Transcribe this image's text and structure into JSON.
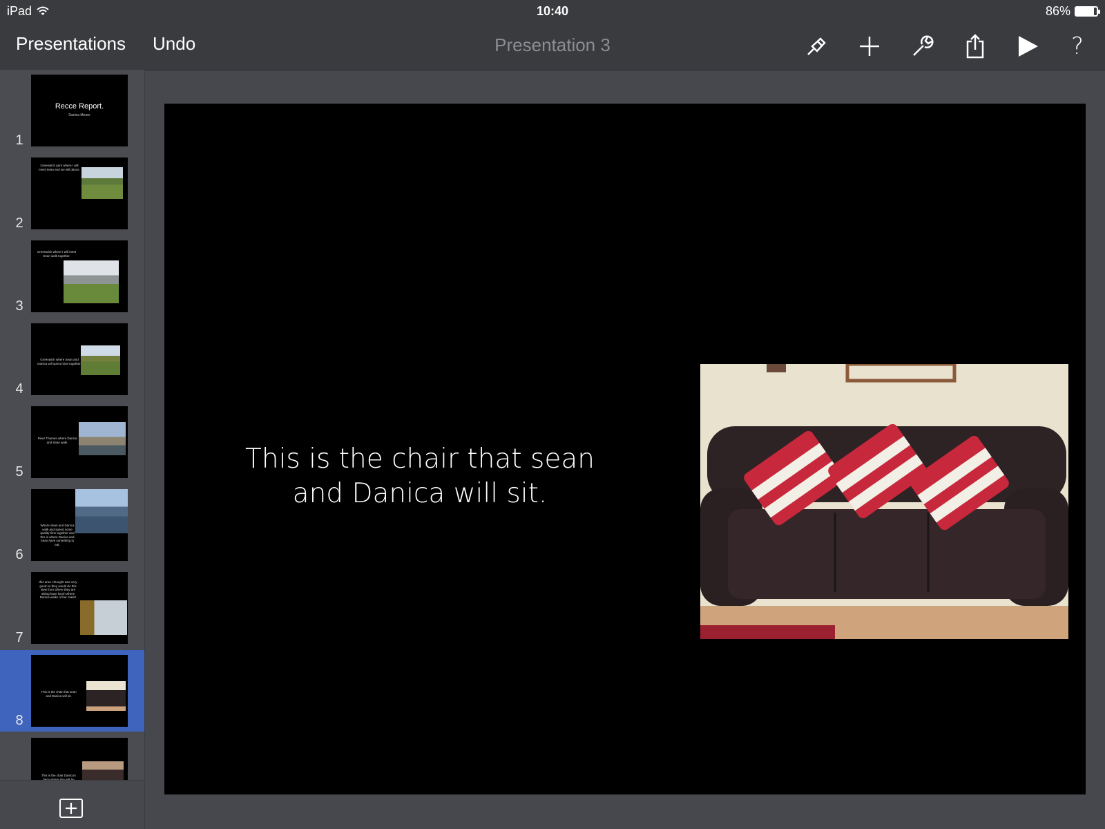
{
  "status_bar": {
    "carrier": "iPad",
    "time": "10:40",
    "battery_percent": "86%",
    "battery_level": 0.86
  },
  "toolbar": {
    "presentations_label": "Presentations",
    "undo_label": "Undo",
    "title": "Presentation 3",
    "icons": [
      "paintbrush-icon",
      "plus-icon",
      "wrench-icon",
      "share-icon",
      "play-icon",
      "help-icon"
    ],
    "help_glyph": "?"
  },
  "sidebar": {
    "selected_index": 8,
    "thumbnails": [
      {
        "number": "1",
        "title": "Recce Report.",
        "subtitle": "Danica Moore"
      },
      {
        "number": "2",
        "text": "Greenwich park where I will meet Sean and we will dance."
      },
      {
        "number": "3",
        "text": "Greenwich where I will meet Sean walk together."
      },
      {
        "number": "4",
        "text": "Greenwich where Sean and Danica will spend time together."
      },
      {
        "number": "5",
        "text": "River Thames where Danica and Sean walk."
      },
      {
        "number": "6",
        "text": "Where Sean and Danica walk and spend some quality time together and this is where Danica and Sean have something to eat."
      },
      {
        "number": "7",
        "text": "this area I thought was very good so they would do this view from where they are sitting have lunch where Danica walks of her match"
      },
      {
        "number": "8",
        "text": "This is the chair that sean and Danica will sit."
      },
      {
        "number": "",
        "text": "This is the chair Danica's fairly where she will be"
      }
    ],
    "add_icon": "plus-square-icon"
  },
  "slide": {
    "text": "This is the chair that sean and Danica will sit.",
    "image": "sofa-photo"
  },
  "colors": {
    "selection": "#3f64bd",
    "toolbar": "#3a3b3f",
    "canvas": "#46484d"
  }
}
